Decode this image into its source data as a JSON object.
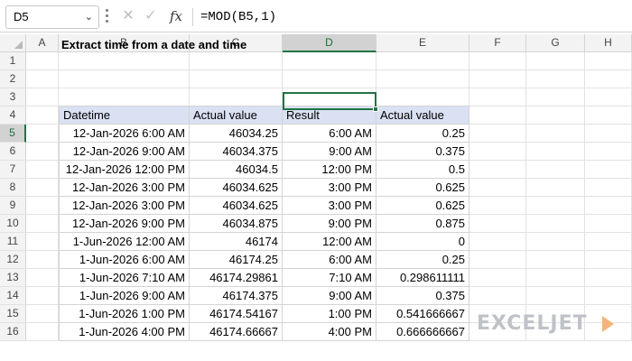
{
  "formula_bar": {
    "name_box": "D5",
    "name_box_chevron": "chevron-down-icon",
    "formula": "=MOD(B5,1)"
  },
  "columns": [
    "A",
    "B",
    "C",
    "D",
    "E",
    "F",
    "G",
    "H"
  ],
  "rows": [
    "1",
    "2",
    "3",
    "4",
    "5",
    "6",
    "7",
    "8",
    "9",
    "10",
    "11",
    "12",
    "13",
    "14",
    "15",
    "16"
  ],
  "active_cell": {
    "column": "D",
    "row": "5"
  },
  "sheet": {
    "title": "Extract time from a date and time",
    "headers": [
      "Datetime",
      "Actual value",
      "Result",
      "Actual value"
    ],
    "rows": [
      [
        "12-Jan-2026 6:00 AM",
        "46034.25",
        "6:00 AM",
        "0.25"
      ],
      [
        "12-Jan-2026 9:00 AM",
        "46034.375",
        "9:00 AM",
        "0.375"
      ],
      [
        "12-Jan-2026 12:00 PM",
        "46034.5",
        "12:00 PM",
        "0.5"
      ],
      [
        "12-Jan-2026 3:00 PM",
        "46034.625",
        "3:00 PM",
        "0.625"
      ],
      [
        "12-Jan-2026 3:00 PM",
        "46034.625",
        "3:00 PM",
        "0.625"
      ],
      [
        "12-Jan-2026 9:00 PM",
        "46034.875",
        "9:00 PM",
        "0.875"
      ],
      [
        "1-Jun-2026 12:00 AM",
        "46174",
        "12:00 AM",
        "0"
      ],
      [
        "1-Jun-2026 6:00 AM",
        "46174.25",
        "6:00 AM",
        "0.25"
      ],
      [
        "1-Jun-2026 7:10 AM",
        "46174.29861",
        "7:10 AM",
        "0.298611111"
      ],
      [
        "1-Jun-2026 9:00 AM",
        "46174.375",
        "9:00 AM",
        "0.375"
      ],
      [
        "1-Jun-2026 1:00 PM",
        "46174.54167",
        "1:00 PM",
        "0.541666667"
      ],
      [
        "1-Jun-2026 4:00 PM",
        "46174.66667",
        "4:00 PM",
        "0.666666667"
      ]
    ]
  },
  "watermark": "EXCELJET",
  "colors": {
    "header_fill": "#d9e1f2",
    "selection": "#217346",
    "watermark_text": "#bfc3c8",
    "watermark_mark": "#f2b57a"
  }
}
